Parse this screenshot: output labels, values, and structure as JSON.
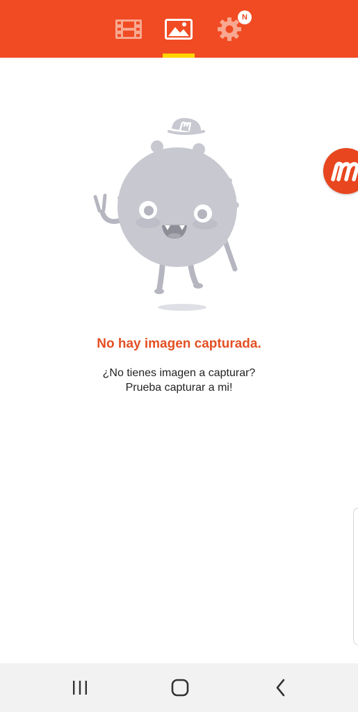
{
  "top_tabs": {
    "items": [
      {
        "id": "videos",
        "icon": "film-icon",
        "selected": false
      },
      {
        "id": "images",
        "icon": "image-icon",
        "selected": true
      },
      {
        "id": "settings",
        "icon": "gear-icon",
        "selected": false
      }
    ],
    "settings_badge": "N"
  },
  "empty_state": {
    "title": "No hay imagen capturada.",
    "message_line1": "¿No tienes imagen a capturar?",
    "message_line2": "Prueba capturar a mi!",
    "illustration_icon": "mascot-illustration"
  },
  "floating_bubble": {
    "icon": "mobizen-logo-icon"
  },
  "nav_bar": {
    "buttons": [
      {
        "id": "recents",
        "icon": "recents-icon"
      },
      {
        "id": "home",
        "icon": "home-icon"
      },
      {
        "id": "back",
        "icon": "back-icon"
      }
    ]
  },
  "colors": {
    "brand": "#f04b23",
    "tab_indicator": "#ffd400",
    "title_text": "#e35024",
    "body_text": "#222222",
    "nav_background": "#f2f2f2"
  }
}
